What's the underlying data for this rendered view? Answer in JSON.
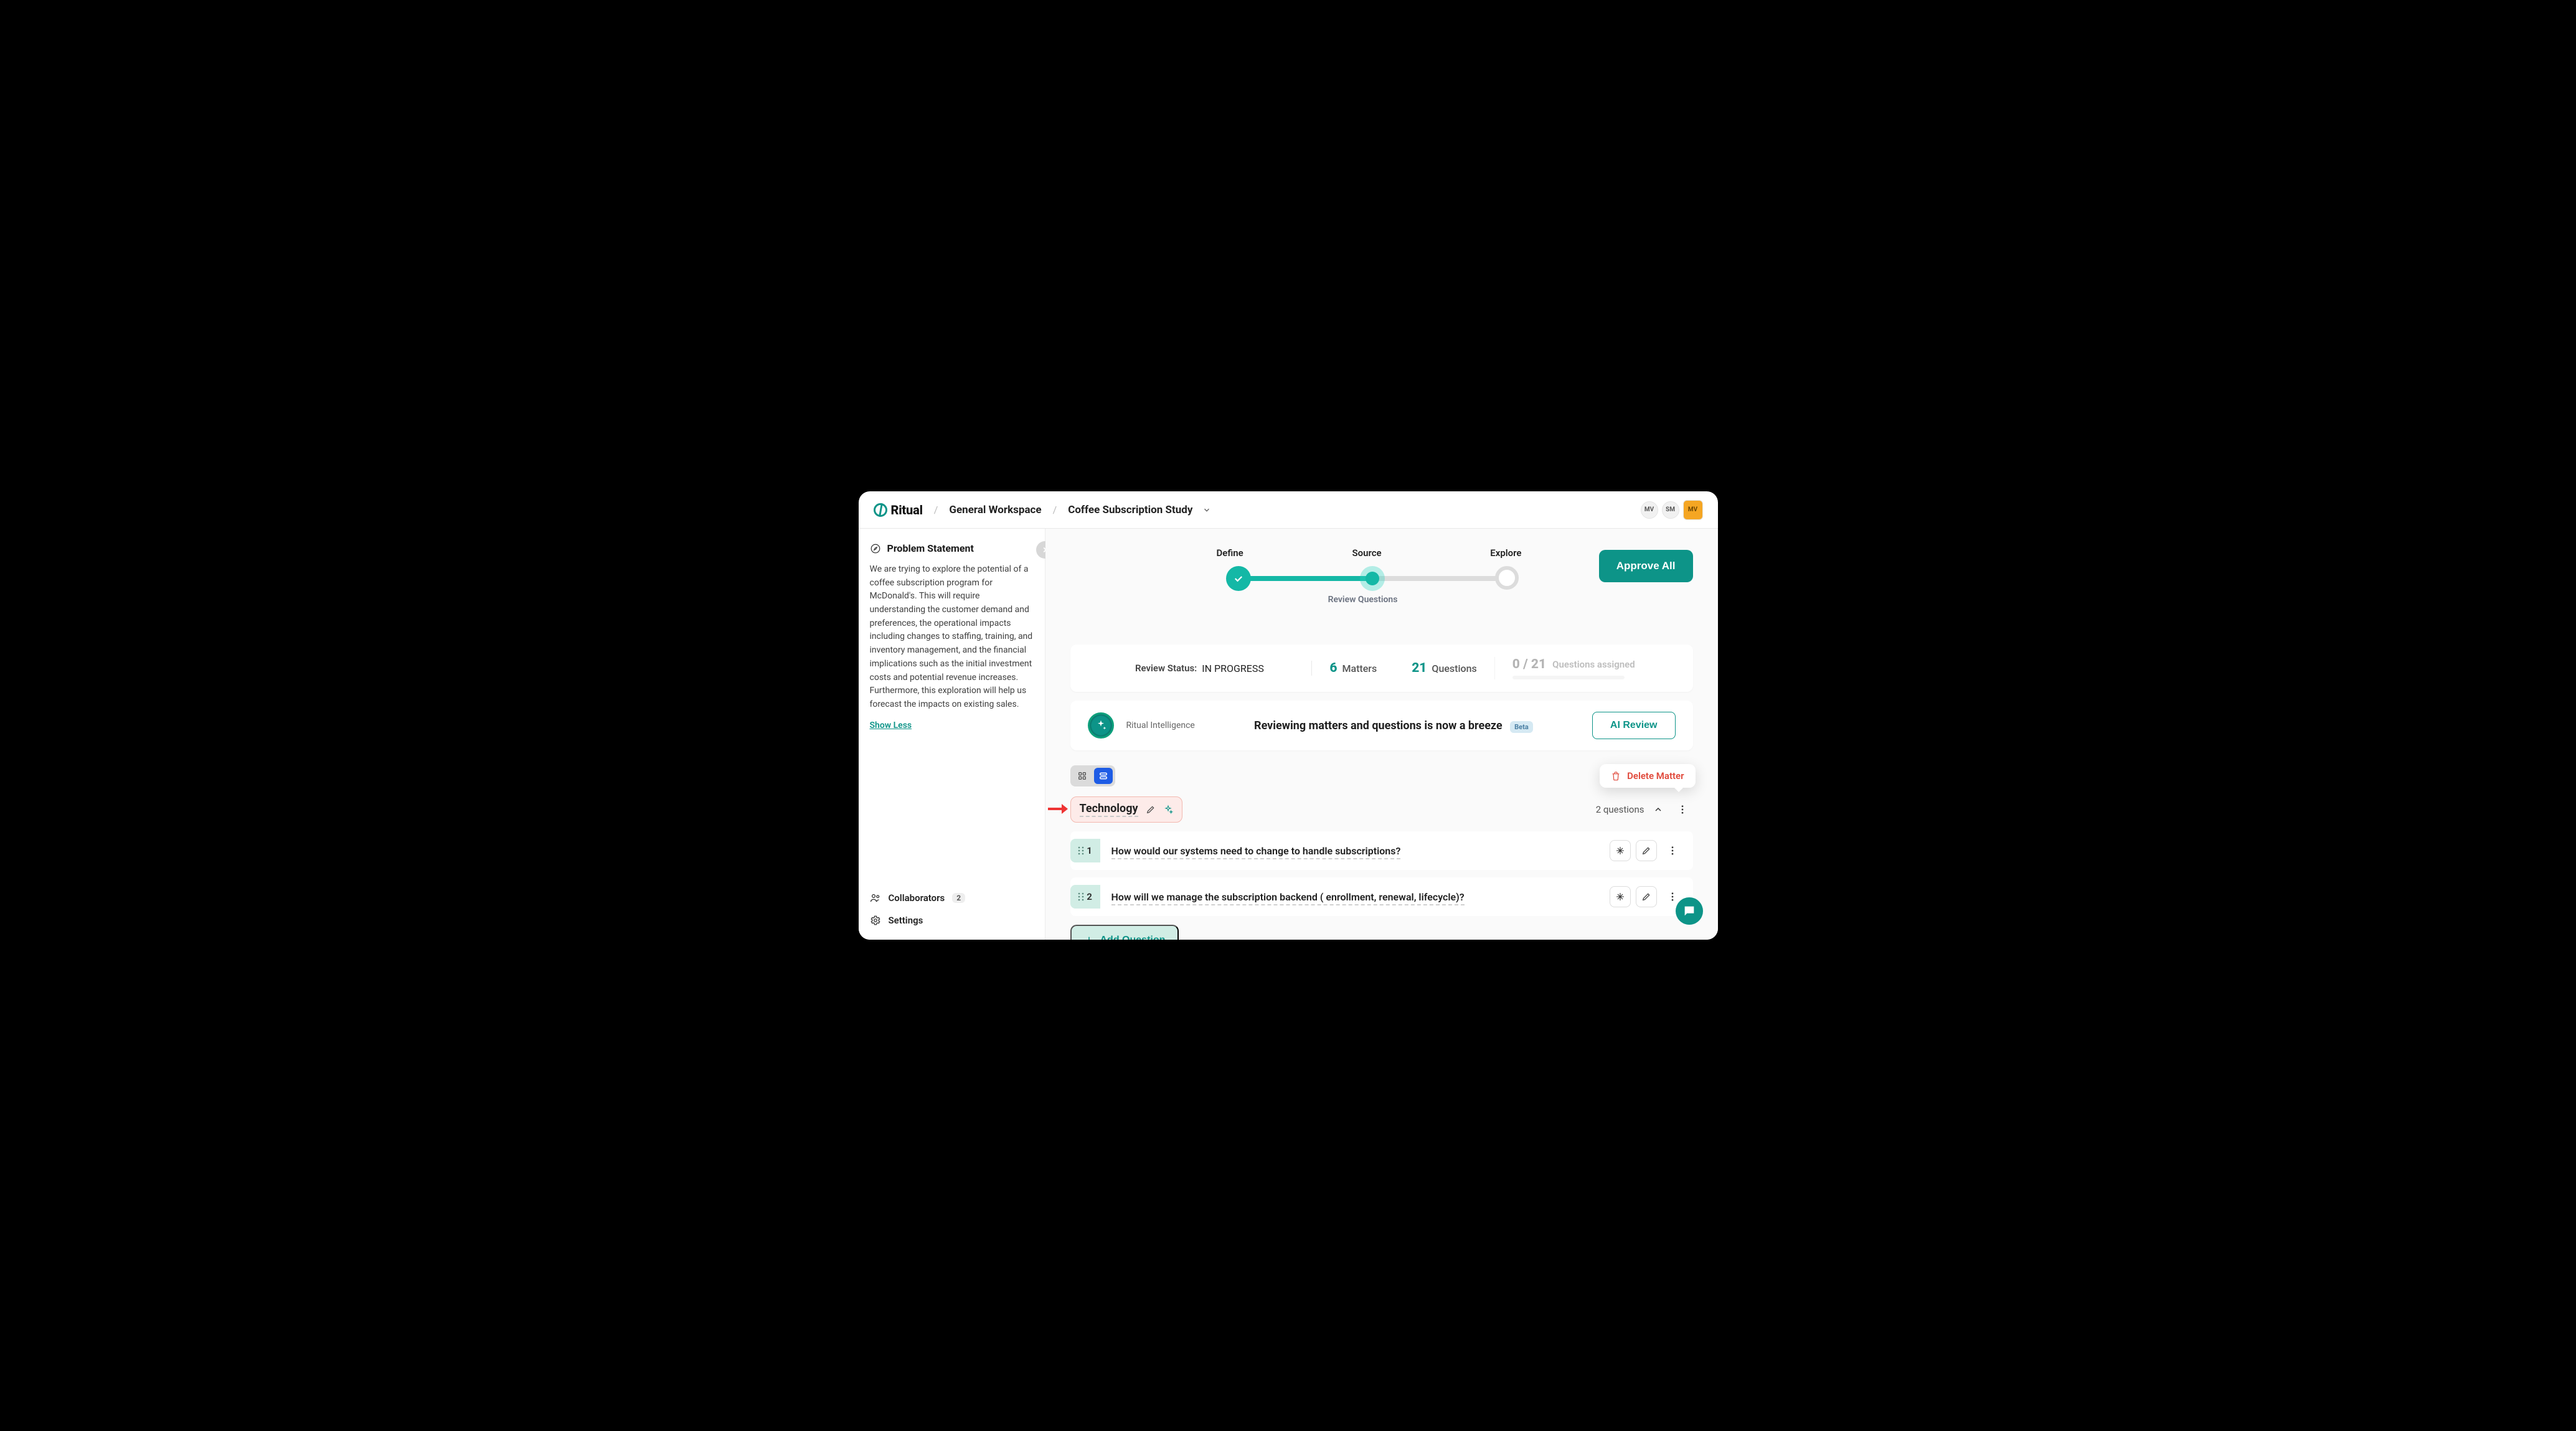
{
  "brand": "Ritual",
  "breadcrumb": {
    "workspace": "General Workspace",
    "project": "Coffee Subscription Study"
  },
  "avatars": {
    "a": "MV",
    "b": "SM",
    "me": "MV"
  },
  "sidebar": {
    "title": "Problem Statement",
    "body": "We are trying to explore the potential of a coffee subscription program for McDonald's. This will require understanding the customer demand and preferences, the operational impacts including changes to staffing, training, and inventory management, and the financial implications such as the initial investment costs and potential revenue increases. Furthermore, this exploration will help us forecast the impacts on existing sales.",
    "toggle": "Show Less",
    "collab_label": "Collaborators",
    "collab_count": "2",
    "settings_label": "Settings"
  },
  "stepper": {
    "define": "Define",
    "source": "Source",
    "explore": "Explore",
    "subtitle": "Review Questions"
  },
  "approve_label": "Approve All",
  "status": {
    "label": "Review Status:",
    "value": "IN PROGRESS",
    "matters_n": "6",
    "matters_w": "Matters",
    "questions_n": "21",
    "questions_w": "Questions",
    "assigned": "0 / 21",
    "assigned_lbl": "Questions assigned"
  },
  "ai": {
    "label": "Ritual Intelligence",
    "headline": "Reviewing matters and questions is now a breeze",
    "badge": "Beta",
    "btn": "AI Review"
  },
  "popover": "Delete Matter",
  "matter": {
    "title": "Technology",
    "count_label": "2 questions"
  },
  "questions": {
    "q1_n": "1",
    "q1_t": "How would our systems need to change to handle subscriptions?",
    "q2_n": "2",
    "q2_t": "How will we manage the subscription backend ( enrollment, renewal, lifecycle)?"
  },
  "add_q": "Add Question"
}
